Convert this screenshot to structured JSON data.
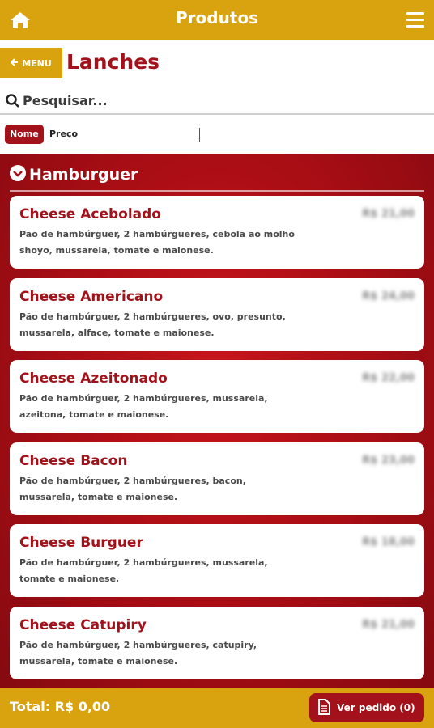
{
  "header": {
    "title": "Produtos",
    "home_icon": "home-icon",
    "menu_icon": "hamburger-menu-icon"
  },
  "nav": {
    "back_label": "MENU",
    "page_title": "Lanches"
  },
  "search": {
    "placeholder": "Pesquisar..."
  },
  "sort": {
    "nome_label": "Nome",
    "preco_label": "Preço"
  },
  "section": {
    "title": "Hamburguer"
  },
  "products": [
    {
      "name": "Cheese Acebolado",
      "desc": "Pão de hambúrguer, 2 hambúrgueres, cebola ao molho shoyo, mussarela, tomate e maionese.",
      "price": "R$ 21,00"
    },
    {
      "name": "Cheese Americano",
      "desc": "Pão de hambúrguer, 2 hambúrgueres, ovo, presunto, mussarela, alface, tomate e maionese.",
      "price": "R$ 24,00"
    },
    {
      "name": "Cheese Azeitonado",
      "desc": "Pão de hambúrguer, 2 hambúrgueres, mussarela, azeitona, tomate e maionese.",
      "price": "R$ 22,00"
    },
    {
      "name": "Cheese Bacon",
      "desc": "Pão de hambúrguer, 2 hambúrgueres, bacon, mussarela, tomate e maionese.",
      "price": "R$ 23,00"
    },
    {
      "name": "Cheese Burguer",
      "desc": "Pão de hambúrguer, 2 hambúrgueres, mussarela, tomate e maionese.",
      "price": "R$ 18,00"
    },
    {
      "name": "Cheese Catupiry",
      "desc": "Pão de hambúrguer, 2 hambúrgueres, catupiry, mussarela, tomate e maionese.",
      "price": "R$ 21,00"
    }
  ],
  "footer": {
    "total": "Total: R$ 0,00",
    "order_label": "Ver pedido (0)"
  },
  "colors": {
    "gold": "#d9a20f",
    "red": "#a3121a"
  }
}
